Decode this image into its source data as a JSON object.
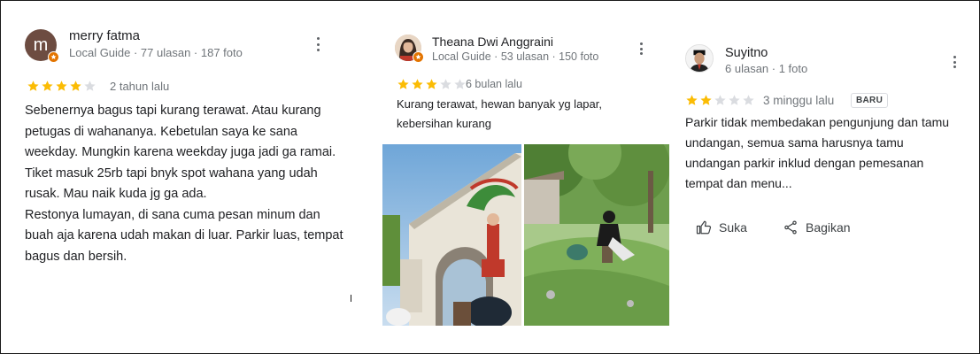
{
  "colors": {
    "star_filled": "#fbbc04",
    "star_empty": "#dadce0",
    "guide_badge": "#e37400",
    "avatar1_bg": "#6d4c41"
  },
  "reviews": [
    {
      "name": "merry fatma",
      "meta": "Local Guide · 77 ulasan · 187 foto",
      "avatar_letter": "m",
      "rating": 4,
      "time": "2 tahun lalu",
      "text": "Sebenernya bagus tapi kurang terawat. Atau kurang petugas di wahananya. Kebetulan saya ke sana weekday. Mungkin karena weekday juga jadi ga ramai.\nTiket masuk 25rb tapi bnyk spot wahana yang udah rusak. Mau naik kuda jg ga ada.\nRestonya lumayan, di sana cuma pesan minum dan buah aja karena udah makan di luar. Parkir luas, tempat bagus dan bersih."
    },
    {
      "name": "Theana Dwi Anggraini",
      "meta": "Local Guide · 53 ulasan · 150 foto",
      "rating": 3,
      "time": "6 bulan lalu",
      "text": "Kurang terawat, hewan banyak yg lapar, kebersihan kurang",
      "photos": [
        "park-entrance-photo",
        "garden-photo"
      ]
    },
    {
      "name": "Suyitno",
      "meta": "6 ulasan · 1 foto",
      "rating": 2,
      "time": "3 minggu lalu",
      "badge": "BARU",
      "text": "Parkir tidak membedakan pengunjung dan tamu undangan, semua sama harusnya tamu undangan parkir inklud dengan pemesanan tempat dan menu...",
      "actions": {
        "like": "Suka",
        "share": "Bagikan"
      }
    }
  ]
}
